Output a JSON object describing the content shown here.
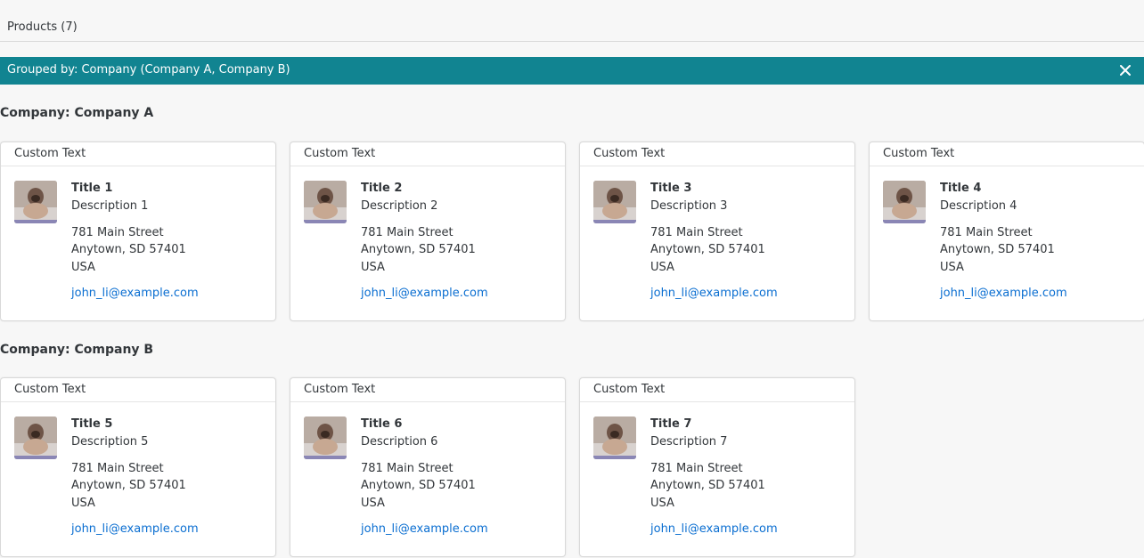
{
  "toolbar": {
    "title": "Products (7)"
  },
  "group_bar": {
    "text": "Grouped by: Company (Company A, Company B)",
    "close_icon": "close-icon"
  },
  "colors": {
    "group_bar": "#118491",
    "link": "#0a6ed1",
    "background": "#f7f7f7"
  },
  "groups": [
    {
      "header": "Company: Company A",
      "cards": [
        {
          "header": "Custom Text",
          "title": "Title 1",
          "description": "Description 1",
          "street": "781 Main Street",
          "city": "Anytown, SD 57401",
          "country": "USA",
          "email": "john_li@example.com"
        },
        {
          "header": "Custom Text",
          "title": "Title 2",
          "description": "Description 2",
          "street": "781 Main Street",
          "city": "Anytown, SD 57401",
          "country": "USA",
          "email": "john_li@example.com"
        },
        {
          "header": "Custom Text",
          "title": "Title 3",
          "description": "Description 3",
          "street": "781 Main Street",
          "city": "Anytown, SD 57401",
          "country": "USA",
          "email": "john_li@example.com"
        },
        {
          "header": "Custom Text",
          "title": "Title 4",
          "description": "Description 4",
          "street": "781 Main Street",
          "city": "Anytown, SD 57401",
          "country": "USA",
          "email": "john_li@example.com"
        }
      ]
    },
    {
      "header": "Company: Company B",
      "cards": [
        {
          "header": "Custom Text",
          "title": "Title 5",
          "description": "Description 5",
          "street": "781 Main Street",
          "city": "Anytown, SD 57401",
          "country": "USA",
          "email": "john_li@example.com"
        },
        {
          "header": "Custom Text",
          "title": "Title 6",
          "description": "Description 6",
          "street": "781 Main Street",
          "city": "Anytown, SD 57401",
          "country": "USA",
          "email": "john_li@example.com"
        },
        {
          "header": "Custom Text",
          "title": "Title 7",
          "description": "Description 7",
          "street": "781 Main Street",
          "city": "Anytown, SD 57401",
          "country": "USA",
          "email": "john_li@example.com"
        }
      ]
    }
  ]
}
